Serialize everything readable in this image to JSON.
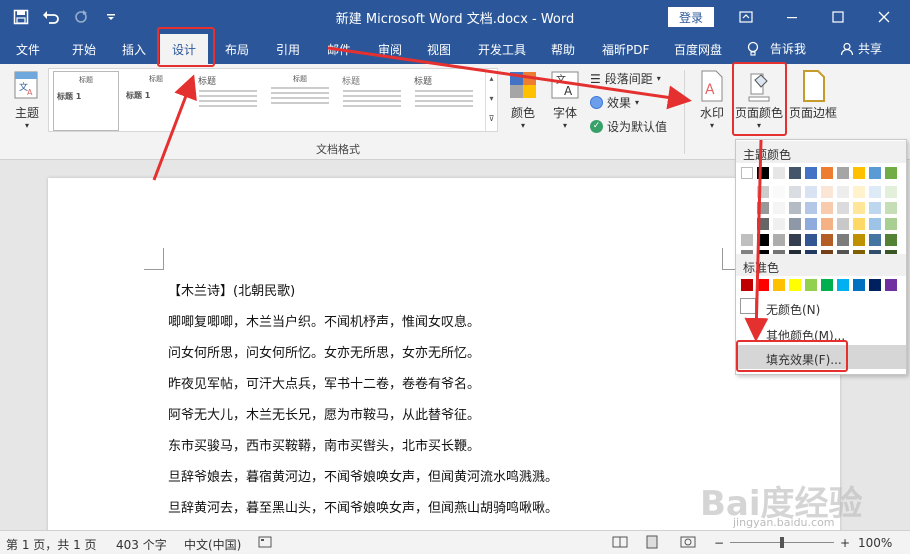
{
  "window": {
    "title": "新建 Microsoft Word 文档.docx  -  Word",
    "login": "登录"
  },
  "tabs": [
    "文件",
    "开始",
    "插入",
    "设计",
    "布局",
    "引用",
    "邮件",
    "审阅",
    "视图",
    "开发工具",
    "帮助",
    "福昕PDF",
    "百度网盘"
  ],
  "tell_me": "告诉我",
  "share": "共享",
  "ribbon": {
    "theme_label": "主题",
    "gallery_heading_1": "标题 1",
    "gallery_title": "标题",
    "gallery_group_label": "文档格式",
    "colors_label": "颜色",
    "fonts_label": "字体",
    "paragraph_spacing": "段落间距",
    "effects": "效果",
    "set_default": "设为默认值",
    "watermark": "水印",
    "page_color": "页面颜色",
    "page_borders": "页面边框"
  },
  "dropdown": {
    "theme_colors_heading": "主题颜色",
    "standard_colors_heading": "标准色",
    "no_color": "无颜色(N)",
    "more_colors": "其他颜色(M)...",
    "fill_effects": "填充效果(F)..."
  },
  "theme_colors": [
    "#ffffff",
    "#000000",
    "#e7e6e6",
    "#44546a",
    "#4472c4",
    "#ed7d31",
    "#a5a5a5",
    "#ffc000",
    "#5b9bd5",
    "#70ad47"
  ],
  "standard_colors": [
    "#c00000",
    "#ff0000",
    "#ffc000",
    "#ffff00",
    "#92d050",
    "#00b050",
    "#00b0f0",
    "#0070c0",
    "#002060",
    "#7030a0"
  ],
  "document": {
    "lines": [
      "【木兰诗】(北朝民歌)",
      "唧唧复唧唧，木兰当户织。不闻机杼声，惟闻女叹息。",
      "问女何所思，问女何所忆。女亦无所思，女亦无所忆。",
      "昨夜见军帖，可汗大点兵，军书十二卷，卷卷有爷名。",
      "阿爷无大儿，木兰无长兄，愿为市鞍马，从此替爷征。",
      "东市买骏马，西市买鞍鞯，南市买辔头，北市买长鞭。",
      "旦辞爷娘去，暮宿黄河边，不闻爷娘唤女声，但闻黄河流水鸣溅溅。",
      "旦辞黄河去，暮至黑山头，不闻爷娘唤女声，但闻燕山胡骑鸣啾啾。"
    ]
  },
  "status": {
    "page": "第 1 页，共 1 页",
    "words": "403 个字",
    "language": "中文(中国)",
    "zoom": "100%"
  },
  "watermark": {
    "logo": "Bai度经验",
    "url": "jingyan.baidu.com"
  }
}
